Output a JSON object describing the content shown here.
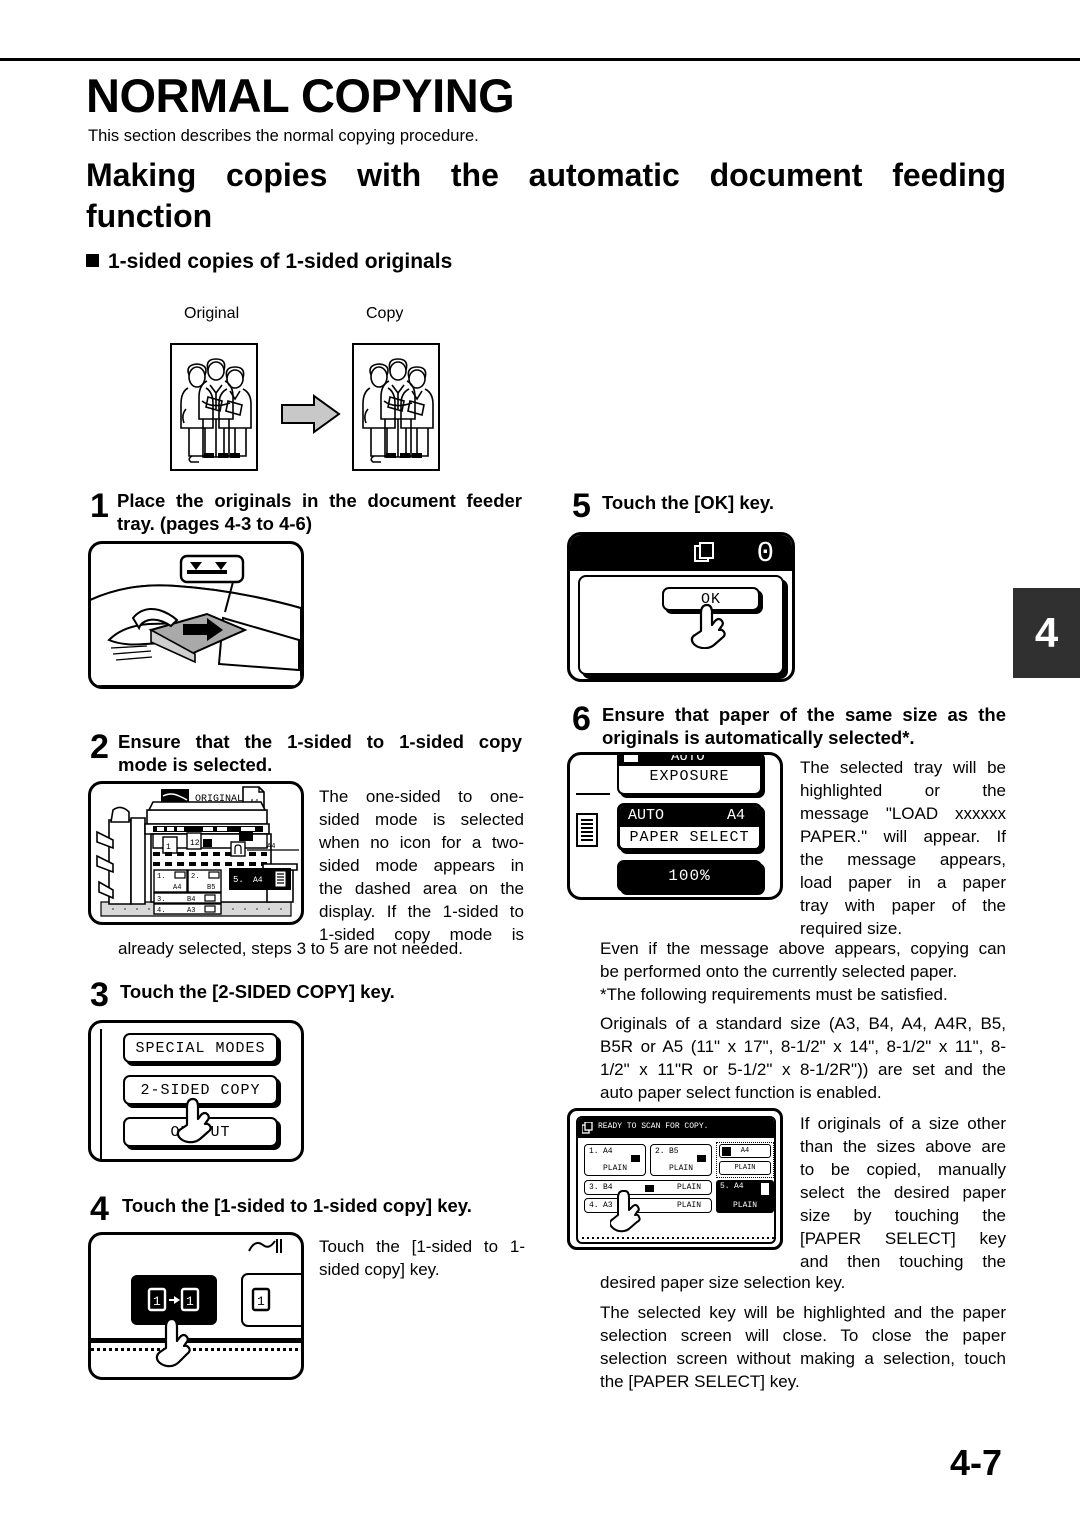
{
  "header": {
    "chapter_tab": "4",
    "page_number": "4-7"
  },
  "title": {
    "h1": "NORMAL COPYING",
    "intro": "This section describes the normal copying procedure.",
    "h2_line1": "Making copies with the automatic document feeding",
    "h2_line2": "function",
    "h3": "1-sided copies of 1-sided originals"
  },
  "figure_original_copy": {
    "original_label": "Original",
    "copy_label": "Copy"
  },
  "steps": {
    "step1": {
      "number": "1",
      "title_line1": "Place the originals in the document feeder",
      "title_line2": "tray. (pages 4-3 to 4-6)"
    },
    "step2": {
      "number": "2",
      "title_line1": "Ensure that the 1-sided to 1-sided copy",
      "title_line2": "mode is selected.",
      "body_lines": [
        "The one-sided to one-",
        "sided mode is selected",
        "when no icon for a two-",
        "sided mode appears in",
        "the dashed area on the",
        "display. If the 1-sided to",
        "1-sided copy mode is"
      ],
      "body_tail": "already selected, steps 3 to 5 are not needed.",
      "display": {
        "original_label": "ORIGINAL",
        "original_size": "A4",
        "paper_size_right": "A4",
        "trays": [
          {
            "index": "1.",
            "size": "A4"
          },
          {
            "index": "2.",
            "size": "B5"
          },
          {
            "index": "3.",
            "size": "B4"
          },
          {
            "index": "4.",
            "size": "A3"
          }
        ],
        "bypass": {
          "index": "5.",
          "size": "A4"
        }
      }
    },
    "step3": {
      "number": "3",
      "title": "Touch the [2-SIDED COPY] key.",
      "keys": [
        "SPECIAL MODES",
        "2-SIDED COPY",
        "OUTPUT"
      ]
    },
    "step4": {
      "number": "4",
      "title": "Touch the [1-sided to 1-sided copy] key.",
      "body_line1": "Touch the [1-sided to 1-",
      "body_line2": "sided copy] key.",
      "key_label": "1→1"
    },
    "step5": {
      "number": "5",
      "title": "Touch the [OK] key.",
      "ok_label": "OK",
      "counter": "0"
    },
    "step6": {
      "number": "6",
      "title_line1": "Ensure that paper of the same size as the",
      "title_line2": "originals is automatically selected*.",
      "display": {
        "auto_cut": "AUTO",
        "exposure": "EXPOSURE",
        "paper_auto": "AUTO",
        "paper_size": "A4",
        "paper_select": "PAPER SELECT",
        "zoom": "100%"
      },
      "body_side_lines": [
        "The selected tray will be",
        "highlighted or the",
        "message \"LOAD xxxxxx",
        "PAPER.\" will appear. If",
        "the message appears,",
        "load paper in a paper",
        "tray with paper of the",
        "required size."
      ],
      "para_even_lines": [
        "Even if the message above appears, copying can",
        "be performed onto the currently selected paper."
      ],
      "para_requirements": "*The following requirements must be satisfied.",
      "para_originals_lines": [
        "Originals of a standard size (A3, B4, A4, A4R, B5,",
        "B5R or A5 (11\" x 17\", 8-1/2\" x 14\", 8-1/2\" x 11\", 8-",
        "1/2\" x 11\"R or 5-1/2\" x 8-1/2R\")) are set and the",
        "auto paper select function is enabled."
      ],
      "para_if_originals_lines": [
        "If originals of a size other",
        "than the sizes above are",
        "to be copied, manually",
        "select the desired paper",
        "size by touching the",
        "[PAPER SELECT] key",
        "and then touching the"
      ],
      "para_if_originals_tail": "desired paper size selection key.",
      "para_selected_key_lines": [
        "The selected key will be highlighted and the paper",
        "selection screen will close. To close the paper",
        "selection screen without making a selection, touch",
        "the [PAPER SELECT] key."
      ],
      "paper_screen": {
        "status": "READY TO SCAN FOR COPY.",
        "trays": [
          {
            "index": "1.",
            "size": "A4",
            "type": "PLAIN"
          },
          {
            "index": "2.",
            "size": "B5",
            "type": "PLAIN"
          },
          {
            "index": "3.",
            "size": "B4",
            "type": "PLAIN"
          },
          {
            "index": "4.",
            "size": "A3",
            "type": "PLAIN"
          }
        ],
        "bypass": {
          "size": "A4",
          "type": "PLAIN"
        },
        "selected": {
          "index": "5.",
          "size": "A4",
          "type": "PLAIN"
        }
      }
    }
  }
}
